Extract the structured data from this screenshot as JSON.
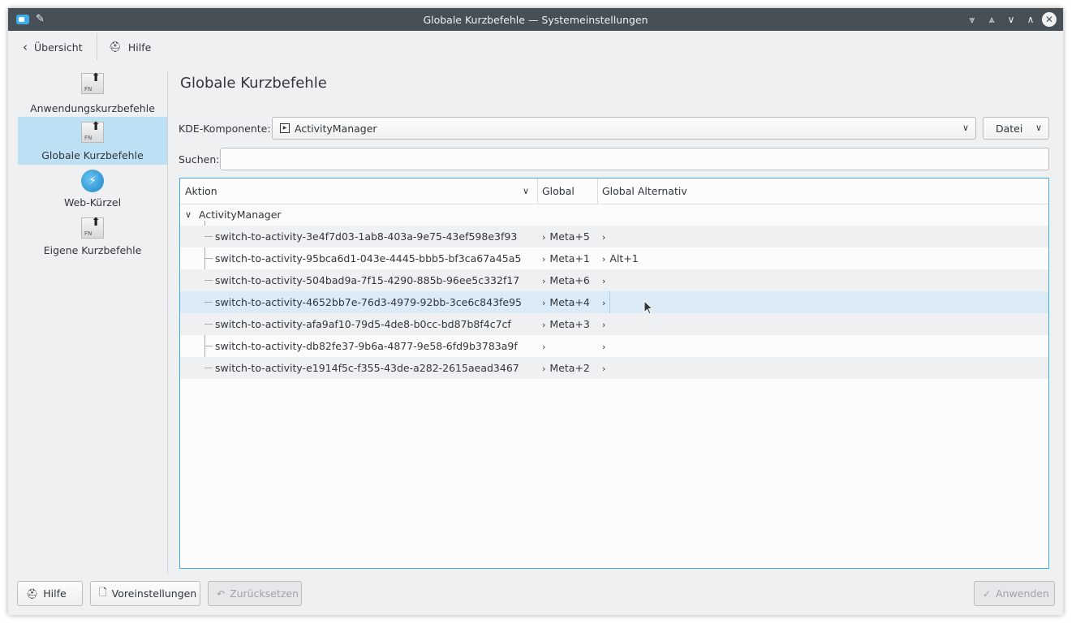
{
  "window": {
    "title": "Globale Kurzbefehle — Systemeinstellungen"
  },
  "toolbar": {
    "back_label": "Übersicht",
    "help_label": "Hilfe"
  },
  "sidebar": {
    "items": [
      {
        "label": "Anwendungskurzbefehle"
      },
      {
        "label": "Globale Kurzbefehle"
      },
      {
        "label": "Web-Kürzel"
      },
      {
        "label": "Eigene Kurzbefehle"
      }
    ]
  },
  "main": {
    "heading": "Globale Kurzbefehle",
    "component_label": "KDE-Komponente:",
    "component_value": "ActivityManager",
    "file_button": "Datei",
    "search_label": "Suchen:",
    "search_value": ""
  },
  "tree": {
    "columns": [
      "Aktion",
      "Global",
      "Global Alternativ"
    ],
    "group": "ActivityManager",
    "rows": [
      {
        "action": "switch-to-activity-3e4f7d03-1ab8-403a-9e75-43ef598e3f93",
        "global": "Meta+5",
        "alt": ""
      },
      {
        "action": "switch-to-activity-95bca6d1-043e-4445-bbb5-bf3ca67a45a5",
        "global": "Meta+1",
        "alt": "Alt+1"
      },
      {
        "action": "switch-to-activity-504bad9a-7f15-4290-885b-96ee5c332f17",
        "global": "Meta+6",
        "alt": ""
      },
      {
        "action": "switch-to-activity-4652bb7e-76d3-4979-92bb-3ce6c843fe95",
        "global": "Meta+4",
        "alt": ""
      },
      {
        "action": "switch-to-activity-afa9af10-79d5-4de8-b0cc-bd87b8f4c7cf",
        "global": "Meta+3",
        "alt": ""
      },
      {
        "action": "switch-to-activity-db82fe37-9b6a-4877-9e58-6fd9b3783a9f",
        "global": "",
        "alt": ""
      },
      {
        "action": "switch-to-activity-e1914f5c-f355-43de-a282-2615aead3467",
        "global": "Meta+2",
        "alt": ""
      }
    ]
  },
  "footer": {
    "help_label": "Hilfe",
    "defaults_label": "Voreinstellungen",
    "reset_label": "Zurücksetzen",
    "apply_label": "Anwenden"
  },
  "colors": {
    "accent": "#3daee9",
    "selection": "#bde0f5",
    "titlebar": "#475057"
  },
  "icons": [
    "app-icon",
    "pin-icon",
    "keep-below-icon",
    "keep-above-icon",
    "minimize-icon",
    "maximize-icon",
    "close-icon",
    "back-icon",
    "help-icon",
    "fn-key-icon",
    "web-shortcut-icon",
    "component-icon",
    "chevron-down-icon",
    "expand-arrow-icon",
    "reset-icon",
    "apply-check-icon",
    "defaults-icon"
  ]
}
